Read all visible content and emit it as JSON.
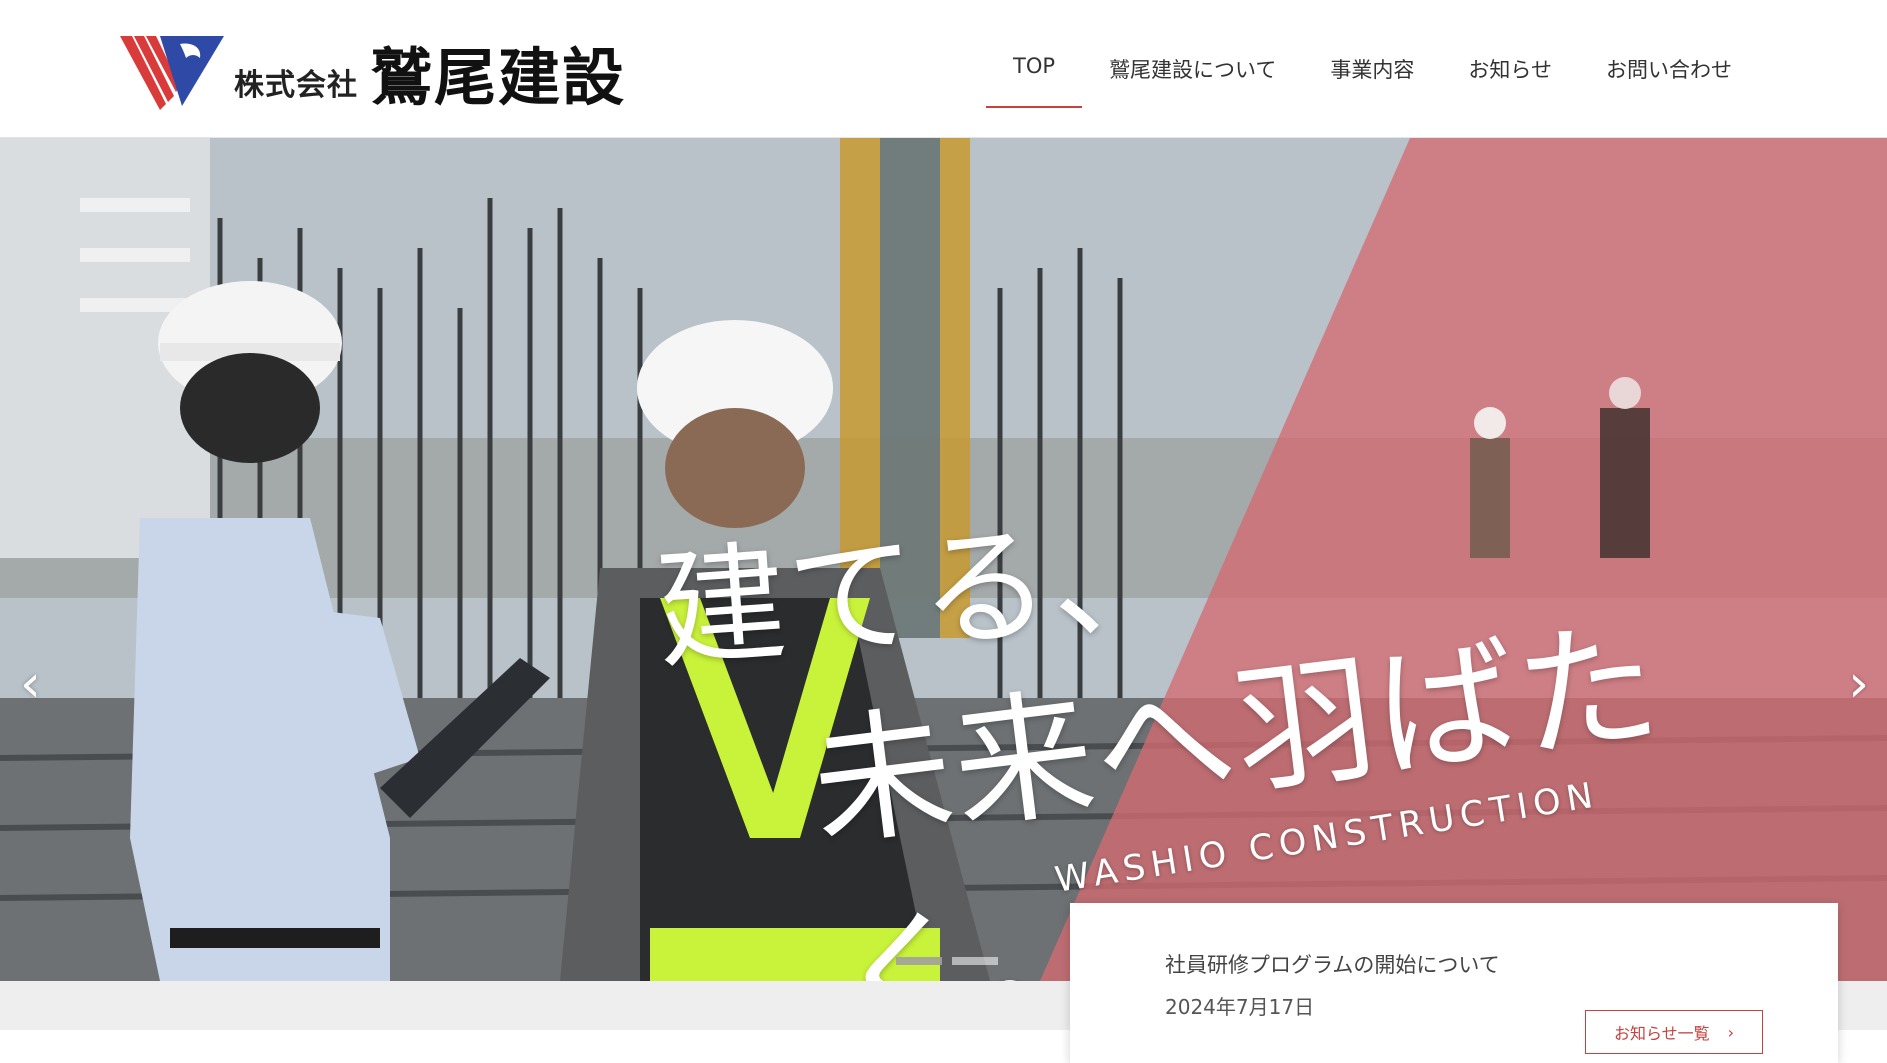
{
  "header": {
    "logo_prefix": "株式会社",
    "logo_name": "鷲尾建設",
    "nav": [
      {
        "label": "TOP",
        "active": true
      },
      {
        "label": "鷲尾建設について",
        "active": false
      },
      {
        "label": "事業内容",
        "active": false
      },
      {
        "label": "お知らせ",
        "active": false
      },
      {
        "label": "お問い合わせ",
        "active": false
      }
    ]
  },
  "hero": {
    "copy_line1": "建てる、",
    "copy_line2": "未来へ羽ばたく。",
    "copy_en": "WASHIO CONSTRUCTION",
    "prev_icon": "‹",
    "next_icon": "›",
    "slides_count": 2,
    "active_slide": 1
  },
  "news": {
    "title": "社員研修プログラムの開始について",
    "date": "2024年7月17日",
    "button_label": "お知らせ一覧",
    "button_icon": "›"
  },
  "colors": {
    "accent": "#c4423f",
    "overlay": "#d36b72",
    "logo_red": "#d93a3a",
    "logo_blue": "#2f4aa6"
  }
}
